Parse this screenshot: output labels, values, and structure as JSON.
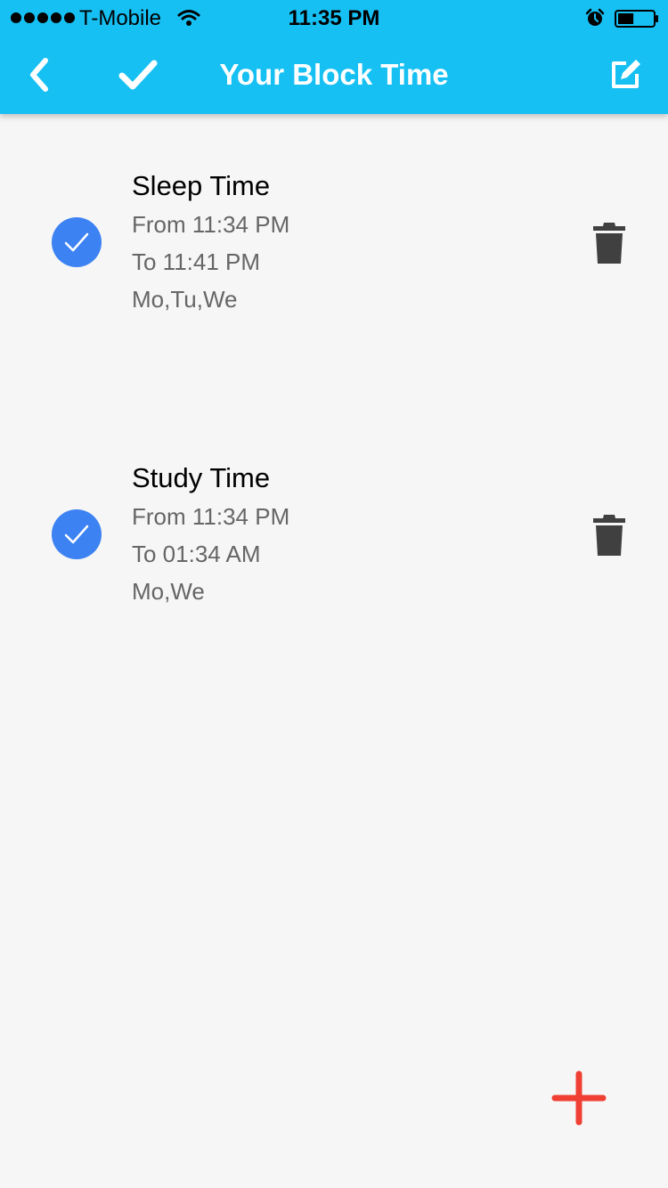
{
  "status_bar": {
    "carrier": "T-Mobile",
    "time": "11:35 PM",
    "signal_icon": "signal-dots-icon",
    "wifi_icon": "wifi-icon",
    "alarm_icon": "alarm-icon",
    "battery_icon": "battery-icon",
    "battery_level": 0.45
  },
  "navbar": {
    "title": "Your Block Time",
    "back_icon": "chevron-left-icon",
    "done_icon": "checkmark-icon",
    "edit_icon": "edit-icon"
  },
  "block_times": [
    {
      "name": "Sleep Time",
      "from": "From 11:34 PM",
      "to": "To 11:41 PM",
      "days": "Mo,Tu,We",
      "enabled": true
    },
    {
      "name": "Study Time",
      "from": "From 11:34 PM",
      "to": "To 01:34 AM",
      "days": "Mo,We",
      "enabled": true
    }
  ],
  "actions": {
    "add_icon": "plus-icon",
    "delete_icon": "trash-icon"
  },
  "colors": {
    "header": "#16c0f3",
    "check": "#3c82f2",
    "add": "#f04034",
    "trash": "#404040",
    "background": "#f6f6f6"
  }
}
